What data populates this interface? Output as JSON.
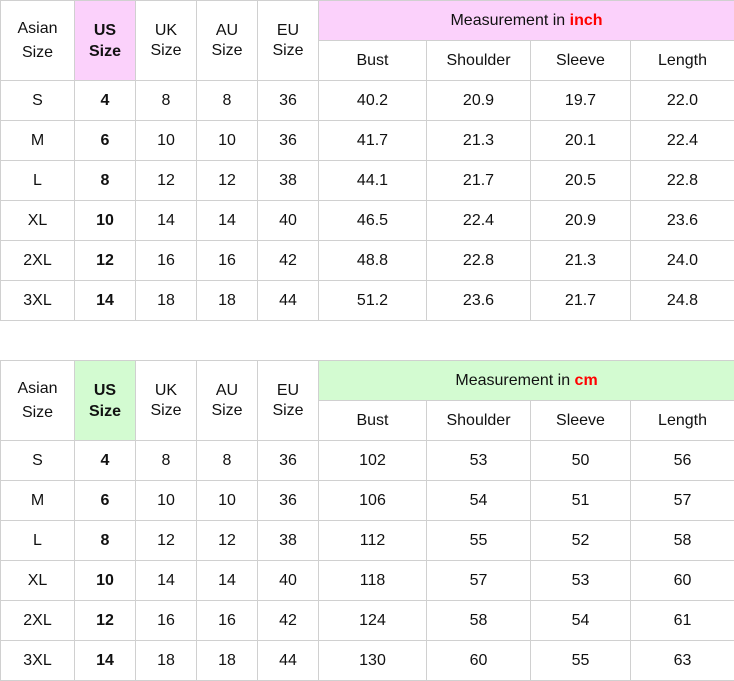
{
  "colors": {
    "inch_header_bg": "#fbd1fb",
    "cm_header_bg": "#d3fbd1",
    "unit_text": "#ff0000",
    "border": "#d0d0d0"
  },
  "tables": [
    {
      "id": "inch",
      "asian_line1": "Asian",
      "asian_line2": "Size",
      "us_line1": "US",
      "us_line2": "Size",
      "uk_line1": "UK",
      "uk_line2": "Size",
      "au_line1": "AU",
      "au_line2": "Size",
      "eu_line1": "EU",
      "eu_line2": "Size",
      "measurement_prefix": "Measurement in ",
      "measurement_unit": "inch",
      "sub_headers": [
        "Bust",
        "Shoulder",
        "Sleeve",
        "Length"
      ],
      "rows": [
        [
          "S",
          "4",
          "8",
          "8",
          "36",
          "40.2",
          "20.9",
          "19.7",
          "22.0"
        ],
        [
          "M",
          "6",
          "10",
          "10",
          "36",
          "41.7",
          "21.3",
          "20.1",
          "22.4"
        ],
        [
          "L",
          "8",
          "12",
          "12",
          "38",
          "44.1",
          "21.7",
          "20.5",
          "22.8"
        ],
        [
          "XL",
          "10",
          "14",
          "14",
          "40",
          "46.5",
          "22.4",
          "20.9",
          "23.6"
        ],
        [
          "2XL",
          "12",
          "16",
          "16",
          "42",
          "48.8",
          "22.8",
          "21.3",
          "24.0"
        ],
        [
          "3XL",
          "14",
          "18",
          "18",
          "44",
          "51.2",
          "23.6",
          "21.7",
          "24.8"
        ]
      ]
    },
    {
      "id": "cm",
      "asian_line1": "Asian",
      "asian_line2": "Size",
      "us_line1": "US",
      "us_line2": "Size",
      "uk_line1": "UK",
      "uk_line2": "Size",
      "au_line1": "AU",
      "au_line2": "Size",
      "eu_line1": "EU",
      "eu_line2": "Size",
      "measurement_prefix": "Measurement in ",
      "measurement_unit": "cm",
      "sub_headers": [
        "Bust",
        "Shoulder",
        "Sleeve",
        "Length"
      ],
      "rows": [
        [
          "S",
          "4",
          "8",
          "8",
          "36",
          "102",
          "53",
          "50",
          "56"
        ],
        [
          "M",
          "6",
          "10",
          "10",
          "36",
          "106",
          "54",
          "51",
          "57"
        ],
        [
          "L",
          "8",
          "12",
          "12",
          "38",
          "112",
          "55",
          "52",
          "58"
        ],
        [
          "XL",
          "10",
          "14",
          "14",
          "40",
          "118",
          "57",
          "53",
          "60"
        ],
        [
          "2XL",
          "12",
          "16",
          "16",
          "42",
          "124",
          "58",
          "54",
          "61"
        ],
        [
          "3XL",
          "14",
          "18",
          "18",
          "44",
          "130",
          "60",
          "55",
          "63"
        ]
      ]
    }
  ]
}
